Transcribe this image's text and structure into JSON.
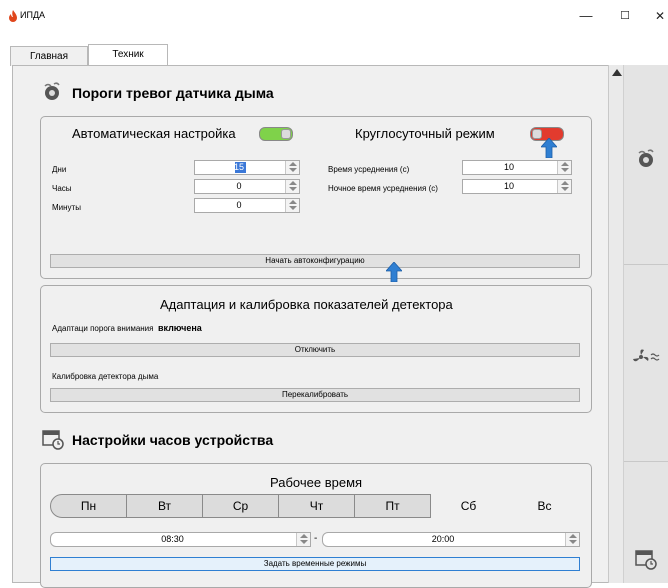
{
  "window": {
    "title": "ИПДА",
    "minimize": "—",
    "maximize": "☐",
    "close": "✕"
  },
  "tabs": [
    {
      "label": "Главная"
    },
    {
      "label": "Техник"
    }
  ],
  "smoke": {
    "heading": "Пороги тревог датчика дыма",
    "auto_label": "Автоматическая настройка",
    "auto_on": true,
    "roundclock_label": "Круглосуточный режим",
    "roundclock_on": false,
    "days_label": "Дни",
    "days_value": "15",
    "hours_label": "Часы",
    "hours_value": "0",
    "minutes_label": "Минуты",
    "minutes_value": "0",
    "avg_label": "Время усреднения (с)",
    "avg_value": "10",
    "night_avg_label": "Ночное время усреднения (с)",
    "night_avg_value": "10",
    "start_button": "Начать автоконфигурацию"
  },
  "adapt": {
    "heading": "Адаптация и калибровка показателей детектора",
    "threshold_label": "Адаптаци порога внимания",
    "threshold_state": "включена",
    "disable_button": "Отключить",
    "calib_label": "Калибровка детектора дыма",
    "recalib_button": "Перекалибровать"
  },
  "clock": {
    "heading": "Настройки часов устройства",
    "work_time": "Рабочее время",
    "days": [
      {
        "label": "Пн",
        "selected": true
      },
      {
        "label": "Вт",
        "selected": true
      },
      {
        "label": "Ср",
        "selected": true
      },
      {
        "label": "Чт",
        "selected": true
      },
      {
        "label": "Пт",
        "selected": true
      },
      {
        "label": "Сб",
        "selected": false
      },
      {
        "label": "Вс",
        "selected": false
      }
    ],
    "start_time": "08:30",
    "dash": "-",
    "end_time": "20:00",
    "set_button": "Задать временные режимы"
  },
  "colors": {
    "toggle_on": "#7fd24a",
    "toggle_off": "#e23b2e",
    "arrow": "#2f7fd2"
  }
}
